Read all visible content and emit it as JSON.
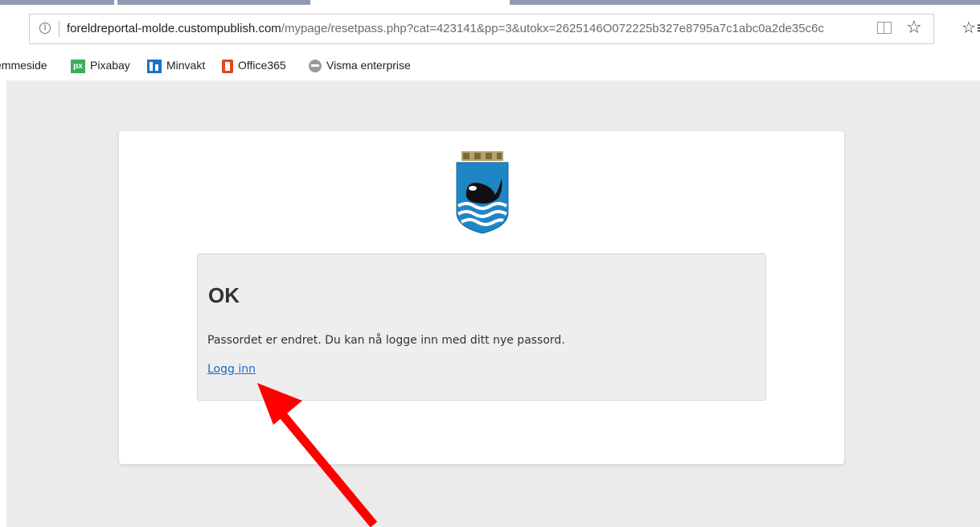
{
  "browser": {
    "url_host": "foreldreportal-molde.custompublish.com",
    "url_rest": "/mypage/resetpass.php?cat=423141&pp=3&utokx=2625146O072225b327e8795a7c1abc0a2de35c6c",
    "info_icon": "i"
  },
  "bookmarks": [
    {
      "label": "emmeside",
      "icon": "none"
    },
    {
      "label": "Pixabay",
      "icon": "px-icon"
    },
    {
      "label": "Minvakt",
      "icon": "minvakt-icon"
    },
    {
      "label": "Office365",
      "icon": "office-icon"
    },
    {
      "label": "Visma enterprise",
      "icon": "visma-icon"
    }
  ],
  "panel": {
    "title": "OK",
    "message": "Passordet er endret. Du kan nå logge inn med ditt nye passord.",
    "link": "Logg inn"
  },
  "colors": {
    "link": "#1a6bc4",
    "arrow": "#ff0000",
    "page_background": "#ebebeb",
    "crest_blue": "#1f86c6"
  }
}
